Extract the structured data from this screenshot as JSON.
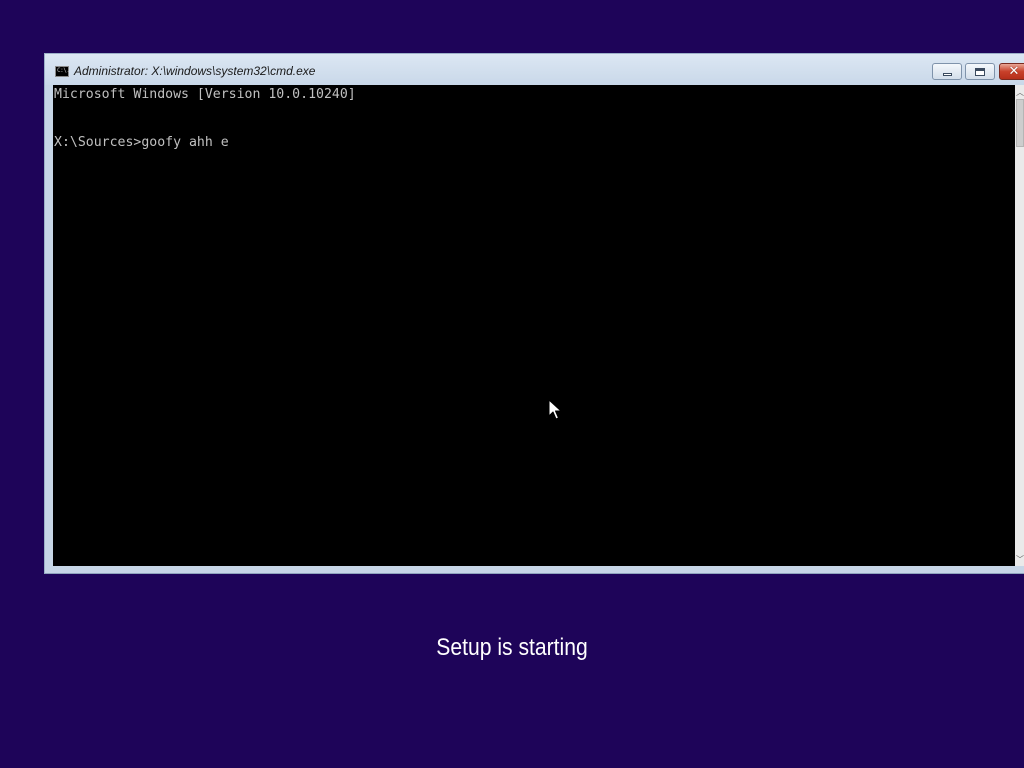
{
  "window": {
    "title": "Administrator: X:\\windows\\system32\\cmd.exe",
    "app_icon_text": "C:\\.",
    "minimize_icon": "minimize-icon",
    "maximize_icon": "maximize-icon",
    "close_icon": "close-icon",
    "close_glyph": "✕"
  },
  "console": {
    "lines": [
      "Microsoft Windows [Version 10.0.10240]",
      "X:\\Sources>goofy ahh e"
    ],
    "background": "#000000",
    "text_color": "#c0c0c0"
  },
  "scrollbar": {
    "up_arrow": "︿",
    "down_arrow": "﹀"
  },
  "setup": {
    "status_text": "Setup is starting"
  },
  "colors": {
    "desktop_background": "#1e0459",
    "close_button": "#c8402a"
  },
  "cursor_icon": "arrow-pointer-icon"
}
